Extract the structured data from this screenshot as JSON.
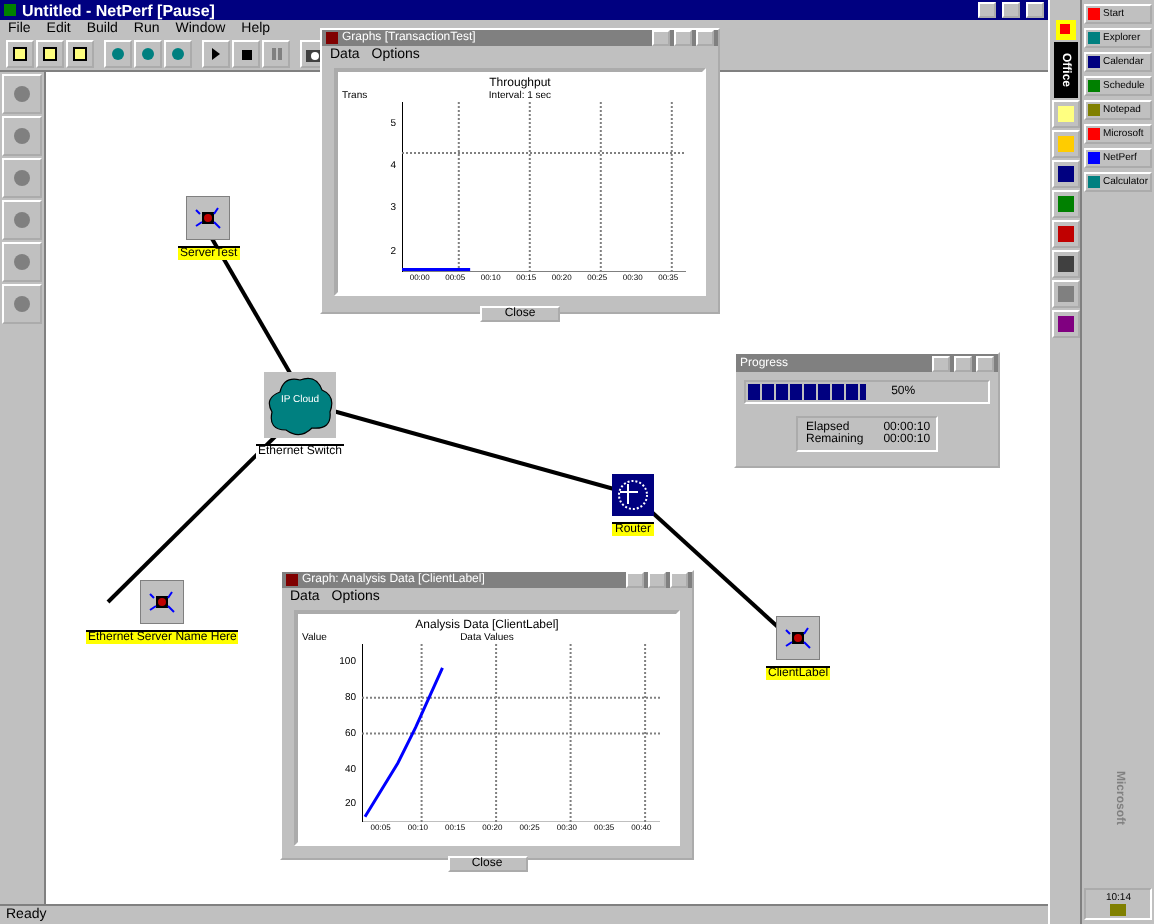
{
  "window": {
    "title": "Untitled - NetPerf [Pause]"
  },
  "menu": [
    "File",
    "Edit",
    "Build",
    "Run",
    "Window",
    "Help"
  ],
  "nodes": [
    {
      "label": "ServerTest",
      "kind": "host"
    },
    {
      "label": "IP Cloud",
      "kind": "cloud",
      "caption": "Ethernet Switch"
    },
    {
      "label": "Ethernet Server Name Here",
      "kind": "host"
    },
    {
      "label": "Router",
      "kind": "router"
    },
    {
      "label": "ClientLabel",
      "kind": "host"
    }
  ],
  "graph_windows": [
    {
      "title": "Graphs [TransactionTest]",
      "menu": [
        "Data",
        "Options"
      ],
      "chart_title": "Throughput",
      "chart_subtitle": "Interval: 1 sec",
      "ylabel": "Trans",
      "yticks": [
        "5",
        "4",
        "3",
        "2"
      ],
      "xticks": [
        "00:00",
        "00:05",
        "00:10",
        "00:15",
        "00:20",
        "00:25",
        "00:30",
        "00:35"
      ],
      "button": "Close",
      "kind": "flat"
    },
    {
      "title": "Graph: Analysis Data [ClientLabel]",
      "menu": [
        "Data",
        "Options"
      ],
      "chart_title": "Analysis Data [ClientLabel]",
      "chart_subtitle": "Data Values",
      "ylabel": "Value",
      "yticks": [
        "100",
        "80",
        "60",
        "40",
        "20"
      ],
      "xticks": [
        "00:05",
        "00:10",
        "00:15",
        "00:20",
        "00:25",
        "00:30",
        "00:35",
        "00:40"
      ],
      "button": "Close",
      "kind": "rising"
    }
  ],
  "progress": {
    "title": "Progress",
    "level": 0.5,
    "reading": "50%",
    "rows": [
      {
        "label": "Elapsed",
        "value": "00:00:10"
      },
      {
        "label": "Remaining",
        "value": "00:00:10"
      }
    ]
  },
  "office_bar": {
    "label": "Office"
  },
  "taskbar": {
    "start": "Start",
    "buttons": [
      "Explorer",
      "Calendar",
      "Schedule",
      "Notepad",
      "Microsoft",
      "NetPerf",
      "Calculator"
    ],
    "brand": "Microsoft",
    "clock": "10:14"
  },
  "status_bar": "Ready"
}
